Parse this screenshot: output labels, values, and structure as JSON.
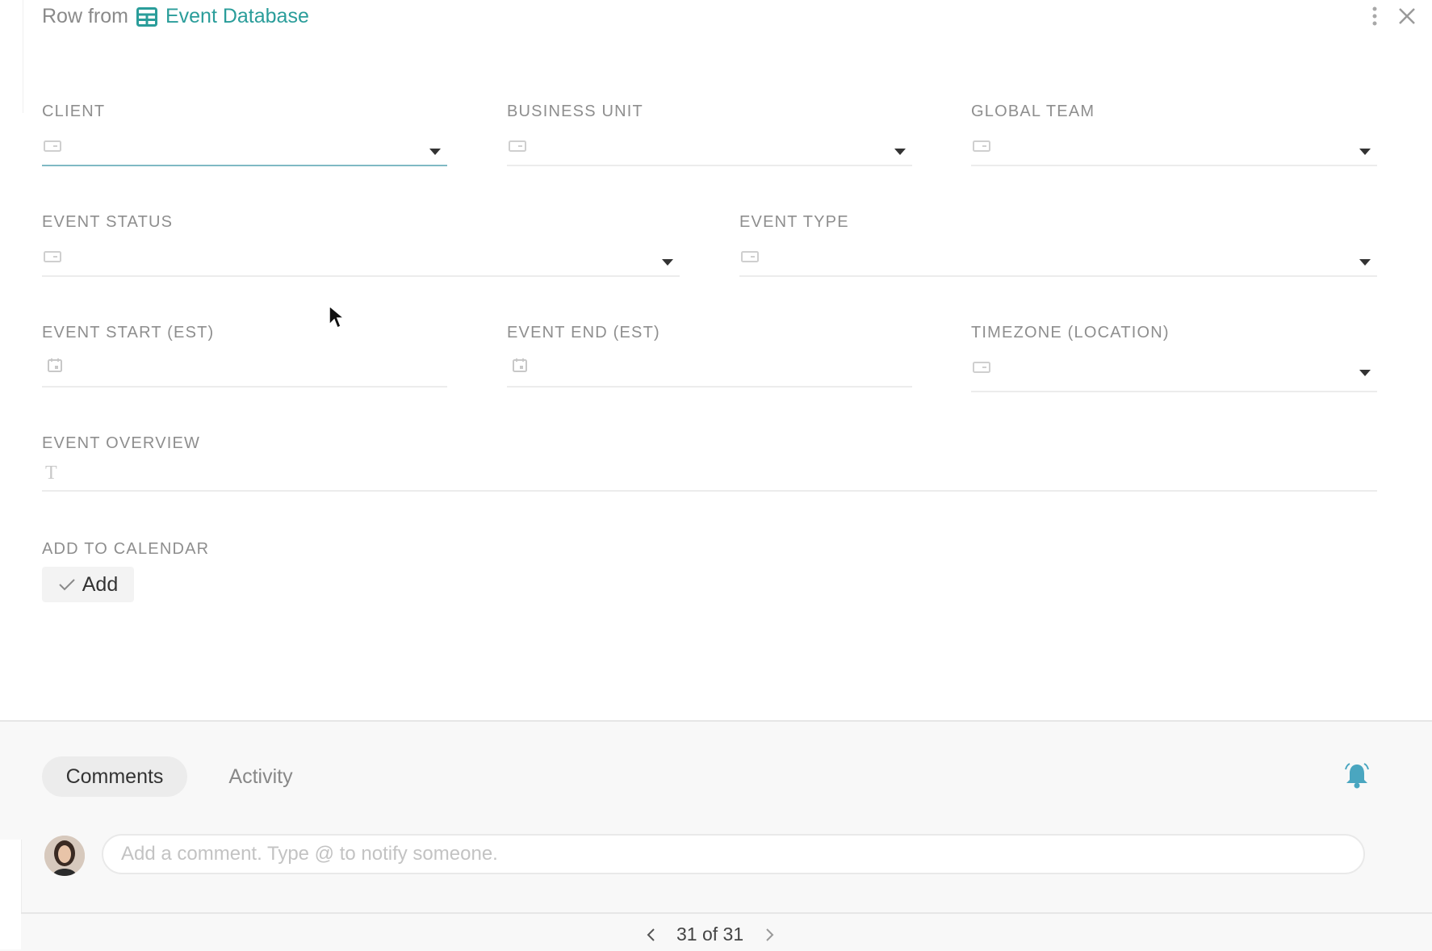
{
  "header": {
    "prefix": "Row from",
    "database_name": "Event Database"
  },
  "fields": {
    "client": {
      "label": "CLIENT",
      "value": ""
    },
    "business_unit": {
      "label": "BUSINESS UNIT",
      "value": ""
    },
    "global_team": {
      "label": "GLOBAL TEAM",
      "value": ""
    },
    "event_status": {
      "label": "EVENT STATUS",
      "value": ""
    },
    "event_type": {
      "label": "EVENT TYPE",
      "value": ""
    },
    "event_start": {
      "label": "EVENT START (EST)",
      "value": ""
    },
    "event_end": {
      "label": "EVENT END (EST)",
      "value": ""
    },
    "timezone": {
      "label": "TIMEZONE (LOCATION)",
      "value": ""
    },
    "event_overview": {
      "label": "EVENT OVERVIEW",
      "value": ""
    },
    "add_to_calendar": {
      "label": "ADD TO CALENDAR",
      "button_label": "Add"
    }
  },
  "comments": {
    "tabs": [
      "Comments",
      "Activity"
    ],
    "active_tab": "Comments",
    "placeholder": "Add a comment. Type @ to notify someone."
  },
  "pager": {
    "text": "31 of 31"
  },
  "colors": {
    "accent": "#2a9d9a",
    "bell": "#4aa6c0",
    "active_underline": "#7fb9c4"
  },
  "icons": [
    "table-icon",
    "more-vertical-icon",
    "close-icon",
    "dropdown-caret-icon",
    "calendar-icon",
    "text-icon",
    "checkmark-icon",
    "bell-icon",
    "chevron-left-icon",
    "chevron-right-icon"
  ]
}
